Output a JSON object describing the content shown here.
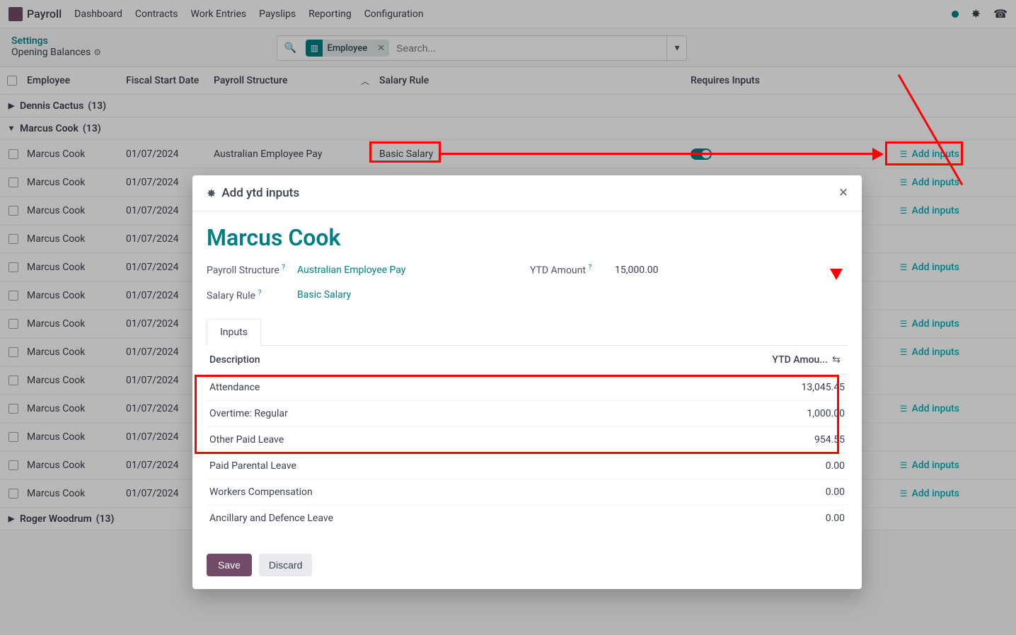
{
  "app": {
    "name": "Payroll"
  },
  "nav": {
    "items": [
      "Dashboard",
      "Contracts",
      "Work Entries",
      "Payslips",
      "Reporting",
      "Configuration"
    ]
  },
  "header": {
    "settings": "Settings",
    "opening_balances": "Opening Balances"
  },
  "search": {
    "tag": "Employee",
    "placeholder": "Search..."
  },
  "columns": {
    "employee": "Employee",
    "fiscal": "Fiscal Start Date",
    "structure": "Payroll Structure",
    "rule": "Salary Rule",
    "requires": "Requires Inputs"
  },
  "groups": [
    {
      "name": "Dennis Cactus",
      "count": "(13)",
      "open": false
    },
    {
      "name": "Marcus Cook",
      "count": "(13)",
      "open": true
    },
    {
      "name": "Roger Woodrum",
      "count": "(13)",
      "open": false
    }
  ],
  "rows": [
    {
      "employee": "Marcus Cook",
      "date": "01/07/2024",
      "structure": "Australian Employee Pay",
      "rule": "Basic Salary",
      "toggle": true,
      "add": "Add inputs"
    },
    {
      "employee": "Marcus Cook",
      "date": "01/07/2024",
      "structure": "",
      "rule": "",
      "toggle": false,
      "add": "Add inputs"
    },
    {
      "employee": "Marcus Cook",
      "date": "01/07/2024",
      "structure": "",
      "rule": "",
      "toggle": false,
      "add": "Add inputs"
    },
    {
      "employee": "Marcus Cook",
      "date": "01/07/2024",
      "structure": "",
      "rule": "",
      "toggle": false,
      "add": ""
    },
    {
      "employee": "Marcus Cook",
      "date": "01/07/2024",
      "structure": "",
      "rule": "",
      "toggle": false,
      "add": "Add inputs"
    },
    {
      "employee": "Marcus Cook",
      "date": "01/07/2024",
      "structure": "",
      "rule": "",
      "toggle": false,
      "add": ""
    },
    {
      "employee": "Marcus Cook",
      "date": "01/07/2024",
      "structure": "",
      "rule": "",
      "toggle": false,
      "add": "Add inputs"
    },
    {
      "employee": "Marcus Cook",
      "date": "01/07/2024",
      "structure": "",
      "rule": "",
      "toggle": false,
      "add": "Add inputs"
    },
    {
      "employee": "Marcus Cook",
      "date": "01/07/2024",
      "structure": "",
      "rule": "",
      "toggle": false,
      "add": ""
    },
    {
      "employee": "Marcus Cook",
      "date": "01/07/2024",
      "structure": "",
      "rule": "",
      "toggle": false,
      "add": "Add inputs"
    },
    {
      "employee": "Marcus Cook",
      "date": "01/07/2024",
      "structure": "",
      "rule": "",
      "toggle": false,
      "add": ""
    },
    {
      "employee": "Marcus Cook",
      "date": "01/07/2024",
      "structure": "",
      "rule": "",
      "toggle": false,
      "add": "Add inputs"
    },
    {
      "employee": "Marcus Cook",
      "date": "01/07/2024",
      "structure": "",
      "rule": "",
      "toggle": false,
      "add": "Add inputs"
    }
  ],
  "modal": {
    "title": "Add ytd inputs",
    "employee": "Marcus Cook",
    "payroll_structure_label": "Payroll Structure",
    "payroll_structure_value": "Australian Employee Pay",
    "salary_rule_label": "Salary Rule",
    "salary_rule_value": "Basic Salary",
    "ytd_amount_label": "YTD Amount",
    "ytd_amount_value": "15,000.00",
    "tab": "Inputs",
    "col_desc": "Description",
    "col_amt": "YTD Amou...",
    "lines": [
      {
        "desc": "Attendance",
        "amt": "13,045.45"
      },
      {
        "desc": "Overtime: Regular",
        "amt": "1,000.00"
      },
      {
        "desc": "Other Paid Leave",
        "amt": "954.55"
      },
      {
        "desc": "Paid Parental Leave",
        "amt": "0.00"
      },
      {
        "desc": "Workers Compensation",
        "amt": "0.00"
      },
      {
        "desc": "Ancillary and Defence Leave",
        "amt": "0.00"
      }
    ],
    "save": "Save",
    "discard": "Discard"
  }
}
